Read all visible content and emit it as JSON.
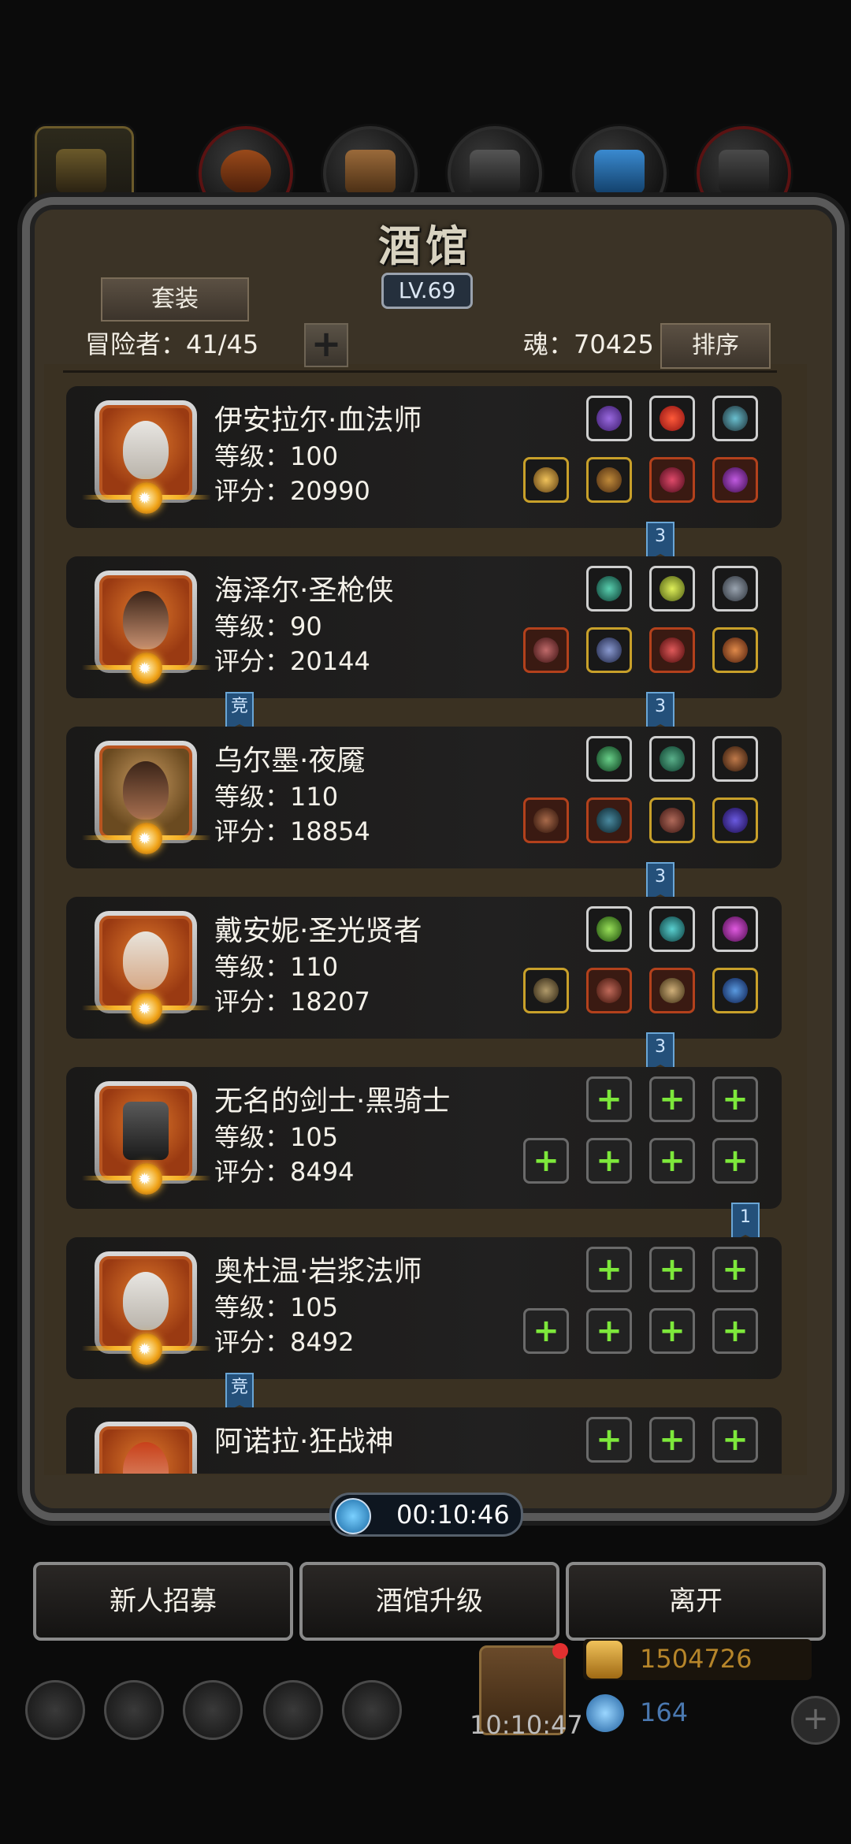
{
  "header": {
    "title": "酒馆",
    "level": "LV.69",
    "set_button": "套装",
    "adventurer_label": "冒险者：41/45",
    "add_label": "+",
    "soul_label": "魂：70425",
    "sort_button": "排序"
  },
  "tabs": [
    {
      "icon": "hood-icon"
    },
    {
      "icon": "armor-icon"
    },
    {
      "icon": "wood-icon"
    },
    {
      "icon": "ingot-icon"
    },
    {
      "icon": "crystal-icon"
    },
    {
      "icon": "ore-icon"
    }
  ],
  "adventurers": [
    {
      "name": "伊安拉尔·血法师",
      "level": "等级：100",
      "score": "评分：20990"
    },
    {
      "name": "海泽尔·圣枪侠",
      "level": "等级：90",
      "score": "评分：20144"
    },
    {
      "name": "乌尔墨·夜魇",
      "level": "等级：110",
      "score": "评分：18854"
    },
    {
      "name": "戴安妮·圣光贤者",
      "level": "等级：110",
      "score": "评分：18207"
    },
    {
      "name": "无名的剑士·黑骑士",
      "level": "等级：105",
      "score": "评分：8494"
    },
    {
      "name": "奥杜温·岩浆法师",
      "level": "等级：105",
      "score": "评分：8492"
    },
    {
      "name": "阿诺拉·狂战神",
      "level": "",
      "score": ""
    }
  ],
  "flags": {
    "set_count_1": "3",
    "set_count_2": "3",
    "set_count_3": "3",
    "set_count_4": "3",
    "set_count_5": "1",
    "arena": "竞"
  },
  "timer": "00:10:46",
  "actions": {
    "recruit": "新人招募",
    "upgrade": "酒馆升级",
    "leave": "离开"
  },
  "bottom": {
    "gift_timer": "10:10:47",
    "gold": "1504726",
    "gems": "164",
    "plus": "+"
  },
  "colors": {
    "frame": "#3b3326",
    "gold": "#c8a02a",
    "green_plus": "#7de83b",
    "flag": "#24507a"
  }
}
